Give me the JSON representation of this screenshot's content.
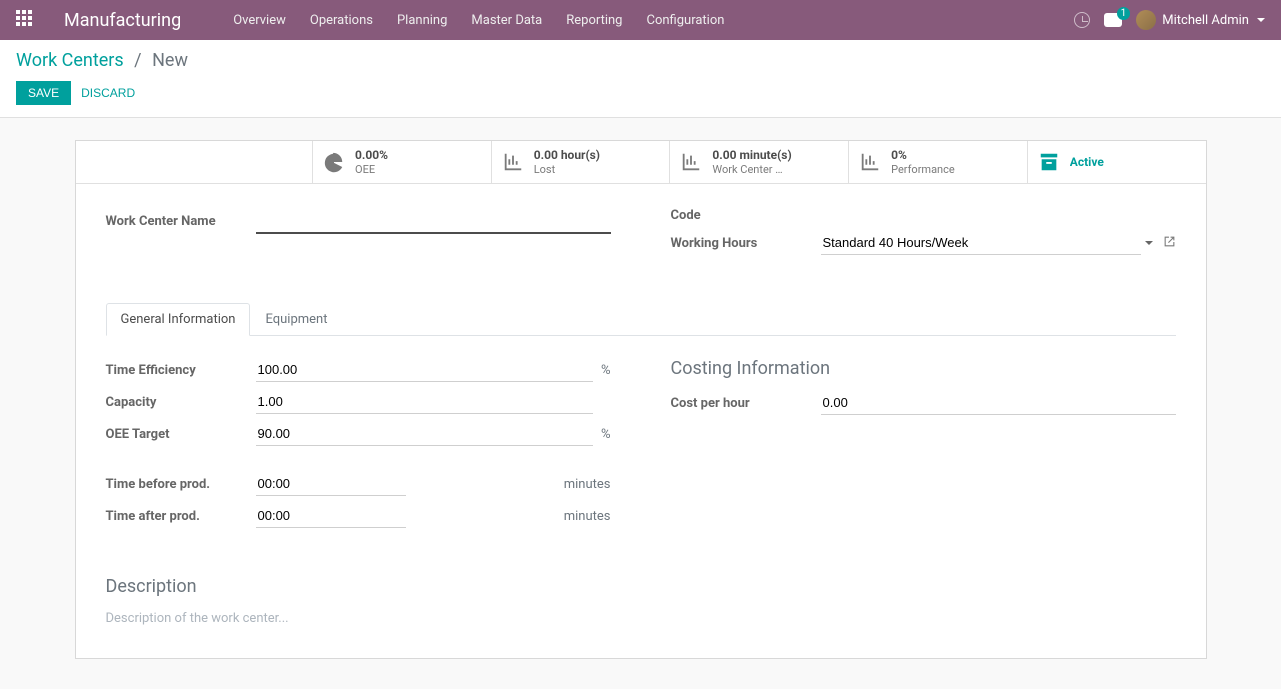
{
  "topbar": {
    "appTitle": "Manufacturing",
    "menu": [
      "Overview",
      "Operations",
      "Planning",
      "Master Data",
      "Reporting",
      "Configuration"
    ],
    "chatBadge": "1",
    "userName": "Mitchell Admin"
  },
  "breadcrumb": {
    "parent": "Work Centers",
    "sep": "/",
    "current": "New"
  },
  "buttons": {
    "save": "SAVE",
    "discard": "DISCARD"
  },
  "stats": {
    "oee": {
      "value": "0.00%",
      "label": "OEE"
    },
    "lost": {
      "value": "0.00 hour(s)",
      "label": "Lost"
    },
    "load": {
      "value": "0.00 minute(s)",
      "label": "Work Center …"
    },
    "perf": {
      "value": "0%",
      "label": "Performance"
    },
    "active": {
      "value": "Active"
    }
  },
  "fields": {
    "workCenterName": {
      "label": "Work Center Name",
      "value": ""
    },
    "code": {
      "label": "Code",
      "value": ""
    },
    "workingHours": {
      "label": "Working Hours",
      "value": "Standard 40 Hours/Week"
    }
  },
  "tabs": {
    "general": "General Information",
    "equipment": "Equipment"
  },
  "general": {
    "timeEfficiency": {
      "label": "Time Efficiency",
      "value": "100.00",
      "suffix": "%"
    },
    "capacity": {
      "label": "Capacity",
      "value": "1.00"
    },
    "oeeTarget": {
      "label": "OEE Target",
      "value": "90.00",
      "suffix": "%"
    },
    "timeBefore": {
      "label": "Time before prod.",
      "value": "00:00",
      "suffix": "minutes"
    },
    "timeAfter": {
      "label": "Time after prod.",
      "value": "00:00",
      "suffix": "minutes"
    }
  },
  "costing": {
    "title": "Costing Information",
    "costPerHour": {
      "label": "Cost per hour",
      "value": "0.00"
    }
  },
  "description": {
    "title": "Description",
    "placeholder": "Description of the work center..."
  }
}
